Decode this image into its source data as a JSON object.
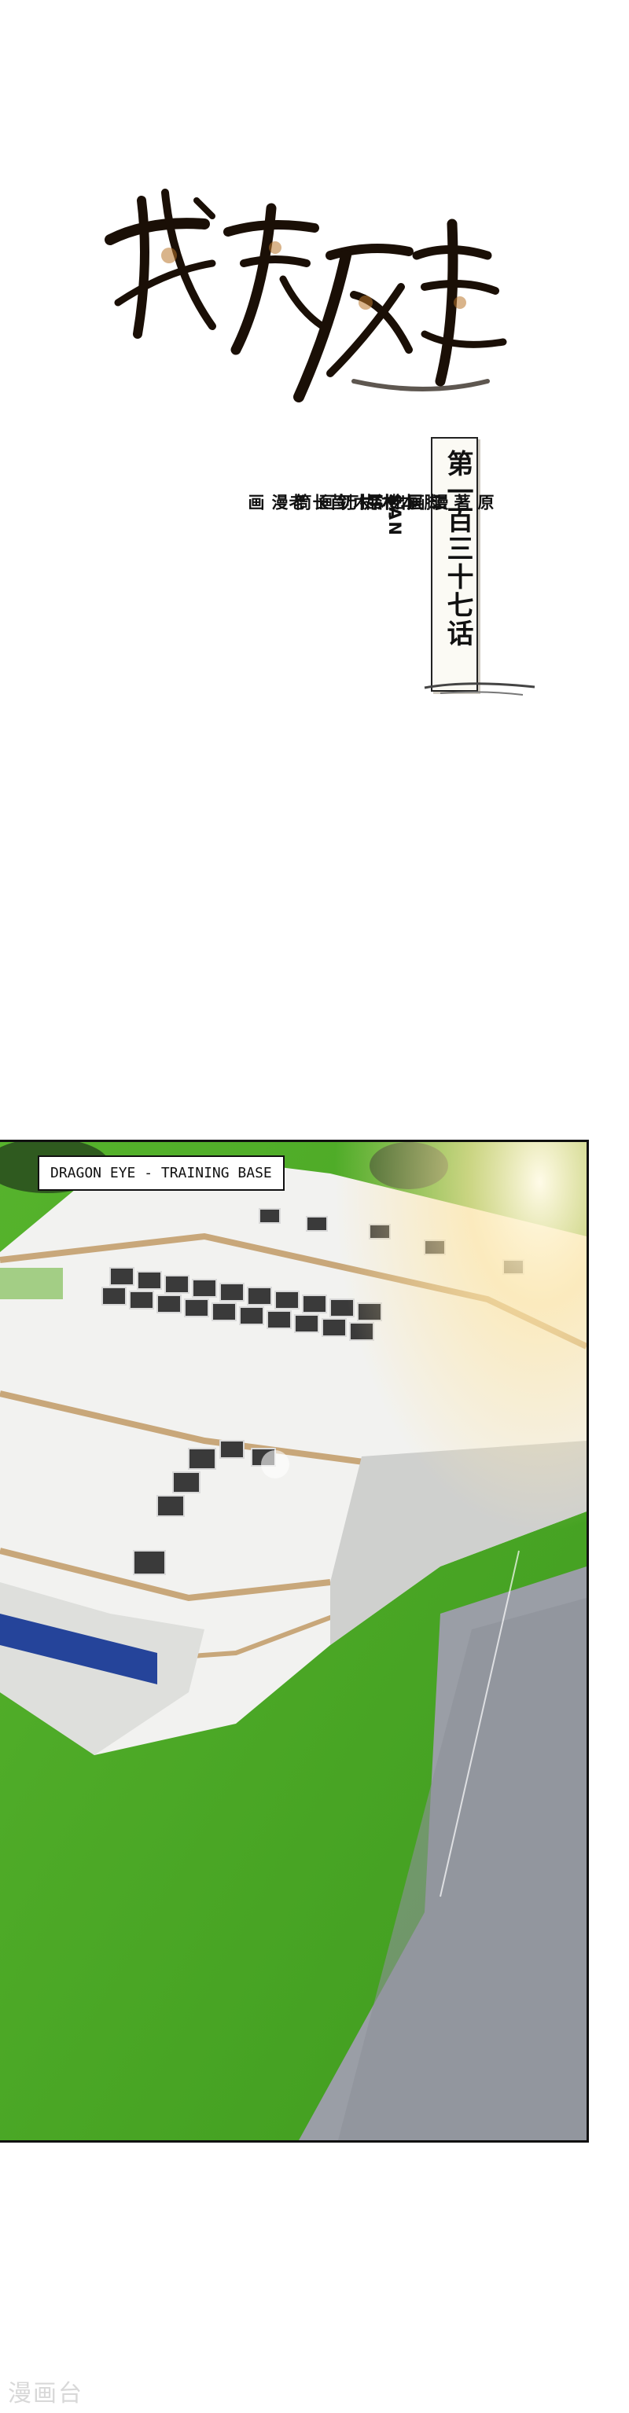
{
  "title_logo": "我为废柴",
  "chapter": "第一百三十七话",
  "credits": [
    {
      "role": "漫画",
      "name": "SAN H"
    },
    {
      "role": "脚本",
      "name": "沐木苜"
    },
    {
      "role": "原著",
      "name": "二层楼-执剑长老"
    },
    {
      "role": "出品",
      "name": "万画筒漫画"
    }
  ],
  "panel": {
    "caption": "DRAGON EYE - TRAINING BASE"
  },
  "watermark": "漫画台"
}
